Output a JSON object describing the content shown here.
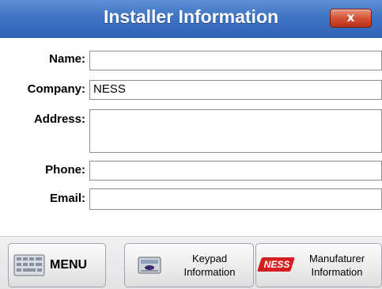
{
  "window": {
    "title": "Installer Information",
    "close_label": "x"
  },
  "form": {
    "name": {
      "label": "Name:",
      "value": ""
    },
    "company": {
      "label": "Company:",
      "value": "NESS"
    },
    "address": {
      "label": "Address:",
      "value": ""
    },
    "phone": {
      "label": "Phone:",
      "value": ""
    },
    "email": {
      "label": "Email:",
      "value": ""
    }
  },
  "buttons": {
    "menu": {
      "label": "MENU",
      "icon": "keyboard-icon"
    },
    "keypad": {
      "line1": "Keypad",
      "line2": "Information",
      "icon": "keypad-icon"
    },
    "manufacturer": {
      "line1": "Manufaturer",
      "line2": "Information",
      "icon": "ness-logo",
      "logo_text": "NESS"
    }
  },
  "colors": {
    "title_bar": "#3f74c4",
    "close_button": "#d45236",
    "logo_red": "#d41f1f"
  }
}
